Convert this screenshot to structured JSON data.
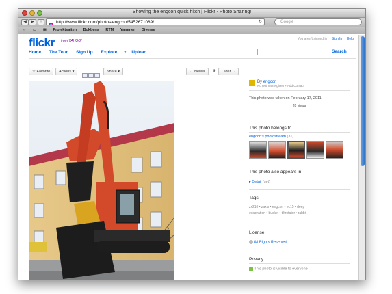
{
  "window": {
    "title": "Showing the engcon quick hitch | Flickr - Photo Sharing!"
  },
  "browser": {
    "url": "http://www.flickr.com/photos/engcon/5452671089/",
    "search_placeholder": "Google",
    "bookmarks": [
      "Projektsajten",
      "Bokbens",
      "RTM",
      "Yammer",
      "Diverse"
    ]
  },
  "header": {
    "logo_a": "flickr",
    "logo_b": "®",
    "from_yahoo": "from YAHOO!",
    "not_signed_in": "You aren't signed in",
    "sign_in": "Sign In",
    "help": "Help",
    "nav": [
      "Home",
      "The Tour",
      "Sign Up",
      "Explore",
      "Upload"
    ],
    "search_label": "Search"
  },
  "actions": {
    "favorite": "Favorite",
    "actions": "Actions",
    "share": "Share",
    "newer": "Newer",
    "older": "Older"
  },
  "owner": {
    "by": "By",
    "name": "engcon",
    "real_name": "No real name given",
    "add_contact": "Add Contact"
  },
  "meta": {
    "taken": "This photo was taken on February 17, 2011.",
    "views": "20 views"
  },
  "belongs": {
    "heading": "This photo belongs to",
    "photostream": "engcon's photostream",
    "count": "(31)"
  },
  "appears": {
    "heading": "This photo also appears in",
    "set": "Detail",
    "set_count": "(set)"
  },
  "tags": {
    "heading": "Tags",
    "row1": [
      "zx210",
      "zaxis",
      "engcon",
      "ec15",
      "deep"
    ],
    "row2": [
      "excavation",
      "bucket",
      "tiltrotator",
      "rabbit"
    ]
  },
  "license": {
    "heading": "License",
    "value": "All Rights Reserved"
  },
  "privacy": {
    "heading": "Privacy",
    "value": "This photo is visible to everyone"
  },
  "colors": {
    "flickr_blue": "#0063dc",
    "flickr_pink": "#ff0084"
  }
}
